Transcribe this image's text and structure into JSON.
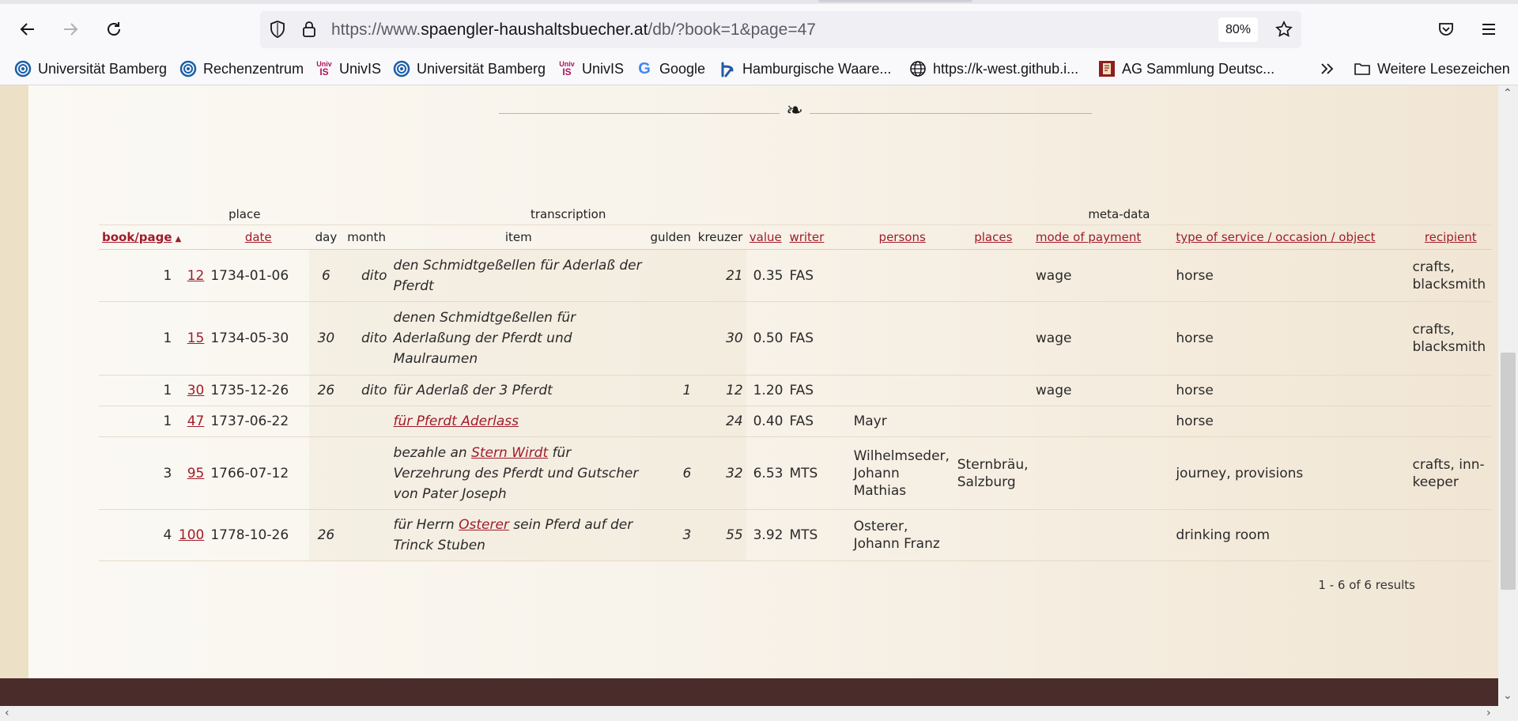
{
  "browser": {
    "url_prefix": "https://www.",
    "url_domain": "spaengler-haushaltsbuecher.at",
    "url_path": "/db/?book=1&page=47",
    "zoom": "80%",
    "bookmarks": [
      {
        "label": "Universität Bamberg",
        "icon": "bamberg-logo-icon"
      },
      {
        "label": "Rechenzentrum",
        "icon": "bamberg-logo-icon"
      },
      {
        "label": "UnivIS",
        "icon": "univis-logo-icon"
      },
      {
        "label": "Universität Bamberg",
        "icon": "bamberg-logo-icon"
      },
      {
        "label": "UnivIS",
        "icon": "univis-logo-icon"
      },
      {
        "label": "Google",
        "icon": "google-logo-icon"
      },
      {
        "label": "Hamburgische Waare...",
        "icon": "hamburg-logo-icon"
      },
      {
        "label": "https://k-west.github.i...",
        "icon": "globe-icon"
      },
      {
        "label": "AG Sammlung Deutsc...",
        "icon": "ag-sammlung-logo-icon"
      }
    ],
    "more_label": "Weitere Lesezeichen",
    "univis_logo": {
      "top": "Univ",
      "bottom": "IS"
    }
  },
  "page": {
    "ornament": "❧",
    "group_headers": {
      "place": "place",
      "transcription": "transcription",
      "meta": "meta-data"
    },
    "columns": {
      "book_page": "book/page",
      "sort_arrow": "▲",
      "date": "date",
      "day": "day",
      "month": "month",
      "item": "item",
      "gulden": "gulden",
      "kreuzer": "kreuzer",
      "value": "value",
      "writer": "writer",
      "persons": "persons",
      "places": "places",
      "mode": "mode of payment",
      "type": "type of service / occasion / object",
      "recipient": "recipient"
    },
    "rows": [
      {
        "book": "1",
        "page": "12",
        "date": "1734-01-06",
        "day": "6",
        "month": "dito",
        "item_line1": "den Schmidtgeßellen für Aderlaß der",
        "item_line2": "Pferdt",
        "item_line3": "",
        "gulden": "",
        "kreuzer": "21",
        "value": "0.35",
        "writer": "FAS",
        "persons_1": "",
        "persons_2": "",
        "persons_3": "",
        "places_1": "",
        "places_2": "",
        "mode": "wage",
        "type": "horse",
        "recipient_1": "crafts,",
        "recipient_2": "blacksmith"
      },
      {
        "book": "1",
        "page": "15",
        "date": "1734-05-30",
        "day": "30",
        "month": "dito",
        "item_line1": "denen Schmidtgeßellen für",
        "item_line2": "Aderlaßung der Pferdt und",
        "item_line3": "Maulraumen",
        "gulden": "",
        "kreuzer": "30",
        "value": "0.50",
        "writer": "FAS",
        "persons_1": "",
        "persons_2": "",
        "persons_3": "",
        "places_1": "",
        "places_2": "",
        "mode": "wage",
        "type": "horse",
        "recipient_1": "crafts,",
        "recipient_2": "blacksmith"
      },
      {
        "book": "1",
        "page": "30",
        "date": "1735-12-26",
        "day": "26",
        "month": "dito",
        "item_line1": "für Aderlaß der 3 Pferdt",
        "gulden": "1",
        "kreuzer": "12",
        "value": "1.20",
        "writer": "FAS",
        "persons_1": "",
        "persons_2": "",
        "persons_3": "",
        "places_1": "",
        "places_2": "",
        "mode": "wage",
        "type": "horse",
        "recipient_1": "",
        "recipient_2": ""
      },
      {
        "book": "1",
        "page": "47",
        "date": "1737-06-22",
        "day": "",
        "month": "",
        "item_link": "für Pferdt Aderlass",
        "gulden": "",
        "kreuzer": "24",
        "value": "0.40",
        "writer": "FAS",
        "persons_1": "Mayr",
        "persons_2": "",
        "persons_3": "",
        "places_1": "",
        "places_2": "",
        "mode": "",
        "type": "horse",
        "recipient_1": "",
        "recipient_2": ""
      },
      {
        "book": "3",
        "page": "95",
        "date": "1766-07-12",
        "day": "",
        "month": "",
        "item_pre": "bezahle an ",
        "item_link": "Stern Wirdt",
        "item_post": " für",
        "item_line2": "Verzehrung des Pferdt und Gutscher",
        "item_line3": "von Pater Joseph",
        "gulden": "6",
        "kreuzer": "32",
        "value": "6.53",
        "writer": "MTS",
        "persons_1": "Wilhelmseder,",
        "persons_2": "Johann",
        "persons_3": "Mathias",
        "places_1": "Sternbräu,",
        "places_2": "Salzburg",
        "mode": "",
        "type": "journey, provisions",
        "recipient_1": "crafts, inn-",
        "recipient_2": "keeper"
      },
      {
        "book": "4",
        "page": "100",
        "date": "1778-10-26",
        "day": "26",
        "month": "",
        "item_pre": "für Herrn ",
        "item_link": "Osterer",
        "item_post": " sein Pferd auf der",
        "item_line2": "Trinck Stuben",
        "gulden": "3",
        "kreuzer": "55",
        "value": "3.92",
        "writer": "MTS",
        "persons_1": "Osterer,",
        "persons_2": "Johann Franz",
        "persons_3": "",
        "places_1": "",
        "places_2": "",
        "mode": "",
        "type": "drinking room",
        "recipient_1": "",
        "recipient_2": ""
      }
    ],
    "result_count": "1 - 6 of 6 results"
  }
}
